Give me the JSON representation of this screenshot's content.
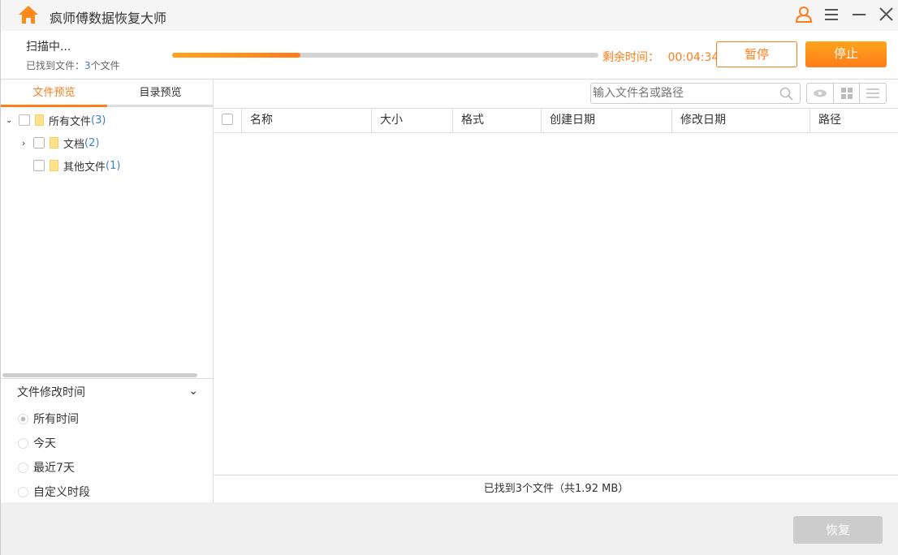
{
  "app": {
    "title": "疯师傅数据恢复大师",
    "accent": "#ff7d1a"
  },
  "scan": {
    "status": "扫描中...",
    "found_label": "已找到文件：",
    "found_count": "3",
    "found_unit": "个文件",
    "progress_percent": 30,
    "remaining_label": "剩余时间：",
    "remaining_time": "00:04:34",
    "pause": "暂停",
    "stop": "停止"
  },
  "tabs": [
    {
      "label": "文件预览",
      "active": true
    },
    {
      "label": "目录预览",
      "active": false
    }
  ],
  "tree": [
    {
      "label": "所有文件",
      "count": "(3)"
    },
    {
      "label": "文档",
      "count": "(2)"
    },
    {
      "label": "其他文件",
      "count": "(1)"
    }
  ],
  "filter": {
    "title": "文件修改时间",
    "options": [
      "所有时间",
      "今天",
      "最近7天",
      "自定义时段"
    ],
    "selected": 0
  },
  "search": {
    "placeholder": "输入文件名或路径"
  },
  "columns": [
    "名称",
    "大小",
    "格式",
    "创建日期",
    "修改日期",
    "路径"
  ],
  "status": "已找到3个文件（共1.92 MB）",
  "recover": "恢复"
}
